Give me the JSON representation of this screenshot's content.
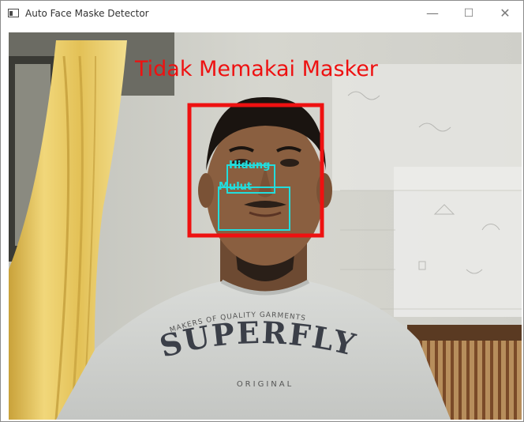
{
  "window": {
    "title": "Auto Face Maske Detector",
    "icon": "window-app-icon",
    "controls": {
      "minimize": "—",
      "maximize": "☐",
      "close": "✕"
    }
  },
  "detection": {
    "status_text": "Tidak Memakai Masker",
    "face_box_color": "#ee1111",
    "feature_color": "#22dddd",
    "features": [
      {
        "label": "Hidung"
      },
      {
        "label": "Mulut"
      }
    ]
  },
  "shirt": {
    "arc_text": "MAKERS OF QUALITY GARMENTS",
    "brand": "SUPERFLY",
    "bottom": "ORIGINAL"
  },
  "colors": {
    "status": "#ee1111",
    "feature_boxes": "#22dddd"
  }
}
